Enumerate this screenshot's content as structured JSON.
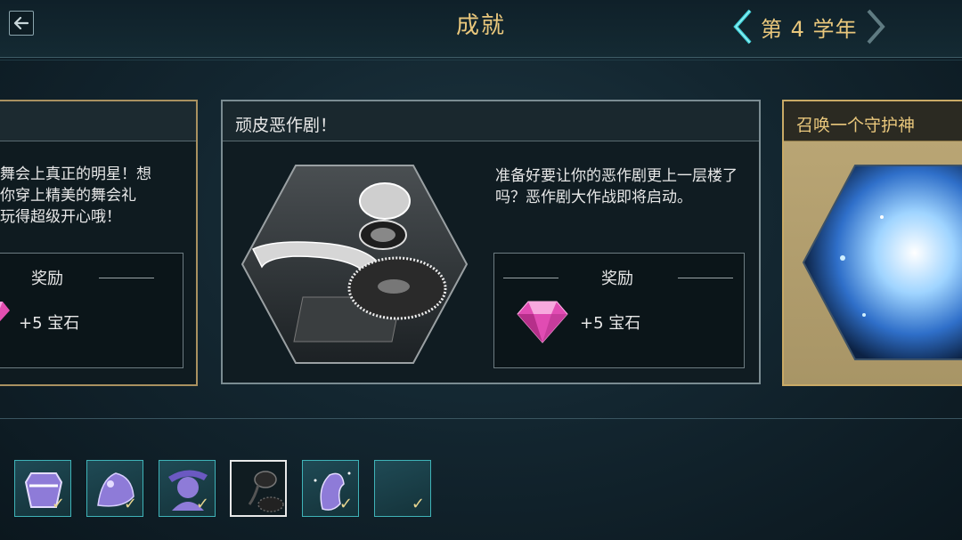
{
  "header": {
    "title": "成就",
    "year_label": "第 4 学年",
    "back_icon": "arrow-left-icon",
    "prev_icon": "chevron-left-icon",
    "next_icon": "chevron-right-icon",
    "accent_color": "#e9c77c"
  },
  "cards": {
    "left": {
      "description": "舞会上真正的明星！想\n你穿上精美的舞会礼\n玩得超级开心哦！",
      "reward_title": "奖励",
      "reward_amount": "+5 宝石"
    },
    "main": {
      "title": "顽皮恶作剧！",
      "description": "准备好要让你的恶作剧更上一层楼了吗？恶作剧大作战即将启动。",
      "reward_title": "奖励",
      "reward_amount": "+5 宝石",
      "reward_icon": "pink-gem-icon",
      "art_icon": "prank-items-icon"
    },
    "right": {
      "title": "召唤一个守护神",
      "art_icon": "patronus-icon"
    }
  },
  "thumbnails": [
    {
      "icon": "dress-robe-icon",
      "completed": true
    },
    {
      "icon": "creature-icon",
      "completed": true
    },
    {
      "icon": "witch-portrait-icon",
      "completed": true
    },
    {
      "icon": "prank-items-icon",
      "completed": false,
      "selected": true
    },
    {
      "icon": "patronus-icon",
      "completed": true
    },
    {
      "icon": "empty-slot-icon",
      "completed": true
    }
  ]
}
